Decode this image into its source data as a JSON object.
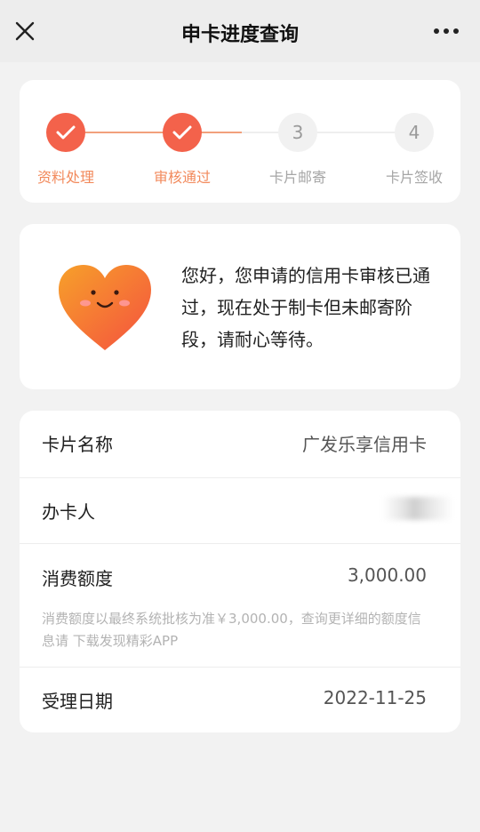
{
  "nav": {
    "title": "申卡进度查询",
    "close_icon": "close-icon",
    "more_icon": "more-dots-icon"
  },
  "steps": [
    {
      "label": "资料处理",
      "status": "done"
    },
    {
      "label": "审核通过",
      "status": "done"
    },
    {
      "label": "卡片邮寄",
      "number": "3",
      "status": "todo"
    },
    {
      "label": "卡片签收",
      "number": "4",
      "status": "todo"
    }
  ],
  "colors": {
    "accent": "#f3624b",
    "done_label": "#f28a5c",
    "todo_label": "#a6a6a6",
    "connector_done": "#f2a07c",
    "connector_todo": "#eeeeee"
  },
  "message": {
    "icon": "smiling-heart-icon",
    "text": "您好，您申请的信用卡审核已通过，现在处于制卡但未邮寄阶段，请耐心等待。"
  },
  "details": {
    "card_name": {
      "key": "卡片名称",
      "value": "广发乐享信用卡"
    },
    "applicant": {
      "key": "办卡人",
      "value": ""
    },
    "credit_limit": {
      "key": "消费额度",
      "value": "3,000.00"
    },
    "limit_note": "消费额度以最终系统批核为准￥3,000.00，查询更详细的额度信息请 下载发现精彩APP",
    "accept_date": {
      "key": "受理日期",
      "value": "2022-11-25"
    }
  }
}
